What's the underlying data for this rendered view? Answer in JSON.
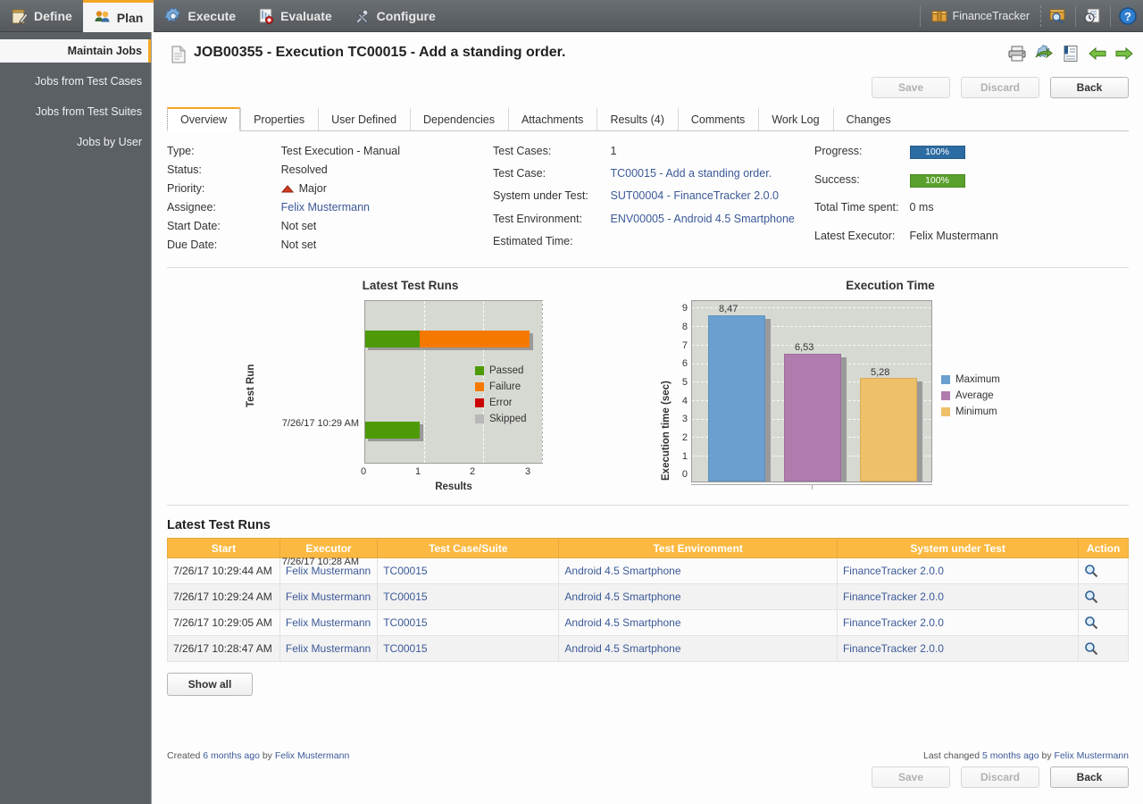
{
  "topnav": {
    "items": [
      {
        "label": "Define",
        "icon": "pencil-notepad-icon",
        "active": false
      },
      {
        "label": "Plan",
        "icon": "people-icon",
        "active": true
      },
      {
        "label": "Execute",
        "icon": "gear-icon",
        "active": false
      },
      {
        "label": "Evaluate",
        "icon": "report-chart-icon",
        "active": false
      },
      {
        "label": "Configure",
        "icon": "tools-icon",
        "active": false
      }
    ],
    "product": {
      "label": "FinanceTracker",
      "icon": "box-icon"
    },
    "buttons": [
      {
        "name": "search-box-icon"
      },
      {
        "name": "recent-items-icon"
      },
      {
        "name": "help-icon"
      }
    ]
  },
  "sidebar": {
    "items": [
      {
        "label": "Maintain Jobs",
        "active": true
      },
      {
        "label": "Jobs from Test Cases",
        "active": false
      },
      {
        "label": "Jobs from Test Suites",
        "active": false
      },
      {
        "label": "Jobs by User",
        "active": false
      }
    ]
  },
  "page": {
    "title": "JOB00355 - Execution TC00015 - Add a standing order.",
    "icon": "document-icon",
    "head_icons": [
      "print-icon",
      "export-icon",
      "report-icon",
      "previous-arrow-icon",
      "next-arrow-icon"
    ]
  },
  "actions": {
    "save": "Save",
    "discard": "Discard",
    "back": "Back"
  },
  "tabs": [
    {
      "label": "Overview",
      "active": true
    },
    {
      "label": "Properties",
      "active": false
    },
    {
      "label": "User Defined",
      "active": false
    },
    {
      "label": "Dependencies",
      "active": false
    },
    {
      "label": "Attachments",
      "active": false
    },
    {
      "label": "Results (4)",
      "active": false
    },
    {
      "label": "Comments",
      "active": false
    },
    {
      "label": "Work Log",
      "active": false
    },
    {
      "label": "Changes",
      "active": false
    }
  ],
  "details": {
    "col1": [
      {
        "label": "Type:",
        "value": "Test Execution - Manual",
        "link": false
      },
      {
        "label": "Status:",
        "value": "Resolved",
        "link": false
      },
      {
        "label": "Priority:",
        "value": "Major",
        "link": false,
        "icon": "priority-major-icon"
      },
      {
        "label": "Assignee:",
        "value": "Felix Mustermann",
        "link": true
      },
      {
        "label": "Start Date:",
        "value": "Not set",
        "link": false
      },
      {
        "label": "Due Date:",
        "value": "Not set",
        "link": false
      }
    ],
    "col2": [
      {
        "label": "Test Cases:",
        "value": "1",
        "link": false
      },
      {
        "label": "Test Case:",
        "value": "TC00015 - Add a standing order.",
        "link": true
      },
      {
        "label": "System under Test:",
        "value": "SUT00004 - FinanceTracker 2.0.0",
        "link": true
      },
      {
        "label": "Test Environment:",
        "value": "ENV00005 - Android 4.5 Smartphone",
        "link": true
      },
      {
        "label": "Estimated Time:",
        "value": "",
        "link": false
      }
    ],
    "col3": [
      {
        "label": "Progress:",
        "value": "100%",
        "bar": true,
        "color": "#2d6ca2"
      },
      {
        "label": "Success:",
        "value": "100%",
        "bar": true,
        "color": "#5aa02c"
      },
      {
        "label": "Total Time spent:",
        "value": "0 ms",
        "bar": false
      },
      {
        "label": "Latest Executor:",
        "value": "Felix Mustermann",
        "bar": false
      }
    ]
  },
  "chart_data": [
    {
      "type": "bar",
      "orientation": "horizontal",
      "stacked": true,
      "title": "Latest Test Runs",
      "xlabel": "Results",
      "ylabel": "Test Run",
      "categories": [
        "7/26/17 10:29 AM",
        "7/26/17 10:28 AM"
      ],
      "xticks": [
        0,
        1,
        2,
        3
      ],
      "xlim": [
        0,
        3.25
      ],
      "grid": true,
      "legend_position": "right",
      "series": [
        {
          "name": "Passed",
          "color": "#4e9a06",
          "values": [
            1,
            1
          ]
        },
        {
          "name": "Failure",
          "color": "#f57900",
          "values": [
            2,
            0
          ]
        },
        {
          "name": "Error",
          "color": "#cc0000",
          "values": [
            0,
            0
          ]
        },
        {
          "name": "Skipped",
          "color": "#b8b8b8",
          "values": [
            0,
            0
          ]
        }
      ]
    },
    {
      "type": "bar",
      "orientation": "vertical",
      "title": "Execution Time",
      "xlabel": "",
      "ylabel": "Execution time (sec)",
      "categories": [
        "Maximum",
        "Average",
        "Minimum"
      ],
      "values": [
        8.47,
        6.53,
        5.28
      ],
      "value_labels": [
        "8,47",
        "6,53",
        "5,28"
      ],
      "yticks": [
        0,
        1,
        2,
        3,
        4,
        5,
        6,
        7,
        8,
        9
      ],
      "ylim": [
        0,
        9.3
      ],
      "grid": true,
      "legend_position": "right",
      "series": [
        {
          "name": "Maximum",
          "color": "#6a9fd0",
          "values": [
            8.47
          ]
        },
        {
          "name": "Average",
          "color": "#b07cae",
          "values": [
            6.53
          ]
        },
        {
          "name": "Minimum",
          "color": "#efc06a",
          "values": [
            5.28
          ]
        }
      ]
    }
  ],
  "runs_table": {
    "heading": "Latest Test Runs",
    "columns": [
      "Start",
      "Executor",
      "Test Case/Suite",
      "Test Environment",
      "System under Test",
      "Action"
    ],
    "rows": [
      {
        "start": "7/26/17 10:29:44 AM",
        "executor": "Felix Mustermann",
        "test_case": "TC00015",
        "environment": "Android 4.5 Smartphone",
        "sut": "FinanceTracker 2.0.0",
        "action": "search-icon"
      },
      {
        "start": "7/26/17 10:29:24 AM",
        "executor": "Felix Mustermann",
        "test_case": "TC00015",
        "environment": "Android 4.5 Smartphone",
        "sut": "FinanceTracker 2.0.0",
        "action": "search-icon"
      },
      {
        "start": "7/26/17 10:29:05 AM",
        "executor": "Felix Mustermann",
        "test_case": "TC00015",
        "environment": "Android 4.5 Smartphone",
        "sut": "FinanceTracker 2.0.0",
        "action": "search-icon"
      },
      {
        "start": "7/26/17 10:28:47 AM",
        "executor": "Felix Mustermann",
        "test_case": "TC00015",
        "environment": "Android 4.5 Smartphone",
        "sut": "FinanceTracker 2.0.0",
        "action": "search-icon"
      }
    ],
    "show_all": "Show all"
  },
  "footer": {
    "created_prefix": "Created ",
    "created_time": "6 months ago",
    "created_by": " by ",
    "created_user": "Felix Mustermann",
    "changed_prefix": "Last changed ",
    "changed_time": "5 months ago",
    "changed_by": " by ",
    "changed_user": "Felix Mustermann"
  },
  "colors": {
    "accent": "#f5a623",
    "table_header": "#fbb942",
    "link": "#3b5998",
    "progress": "#2d6ca2",
    "success": "#5aa02c"
  }
}
